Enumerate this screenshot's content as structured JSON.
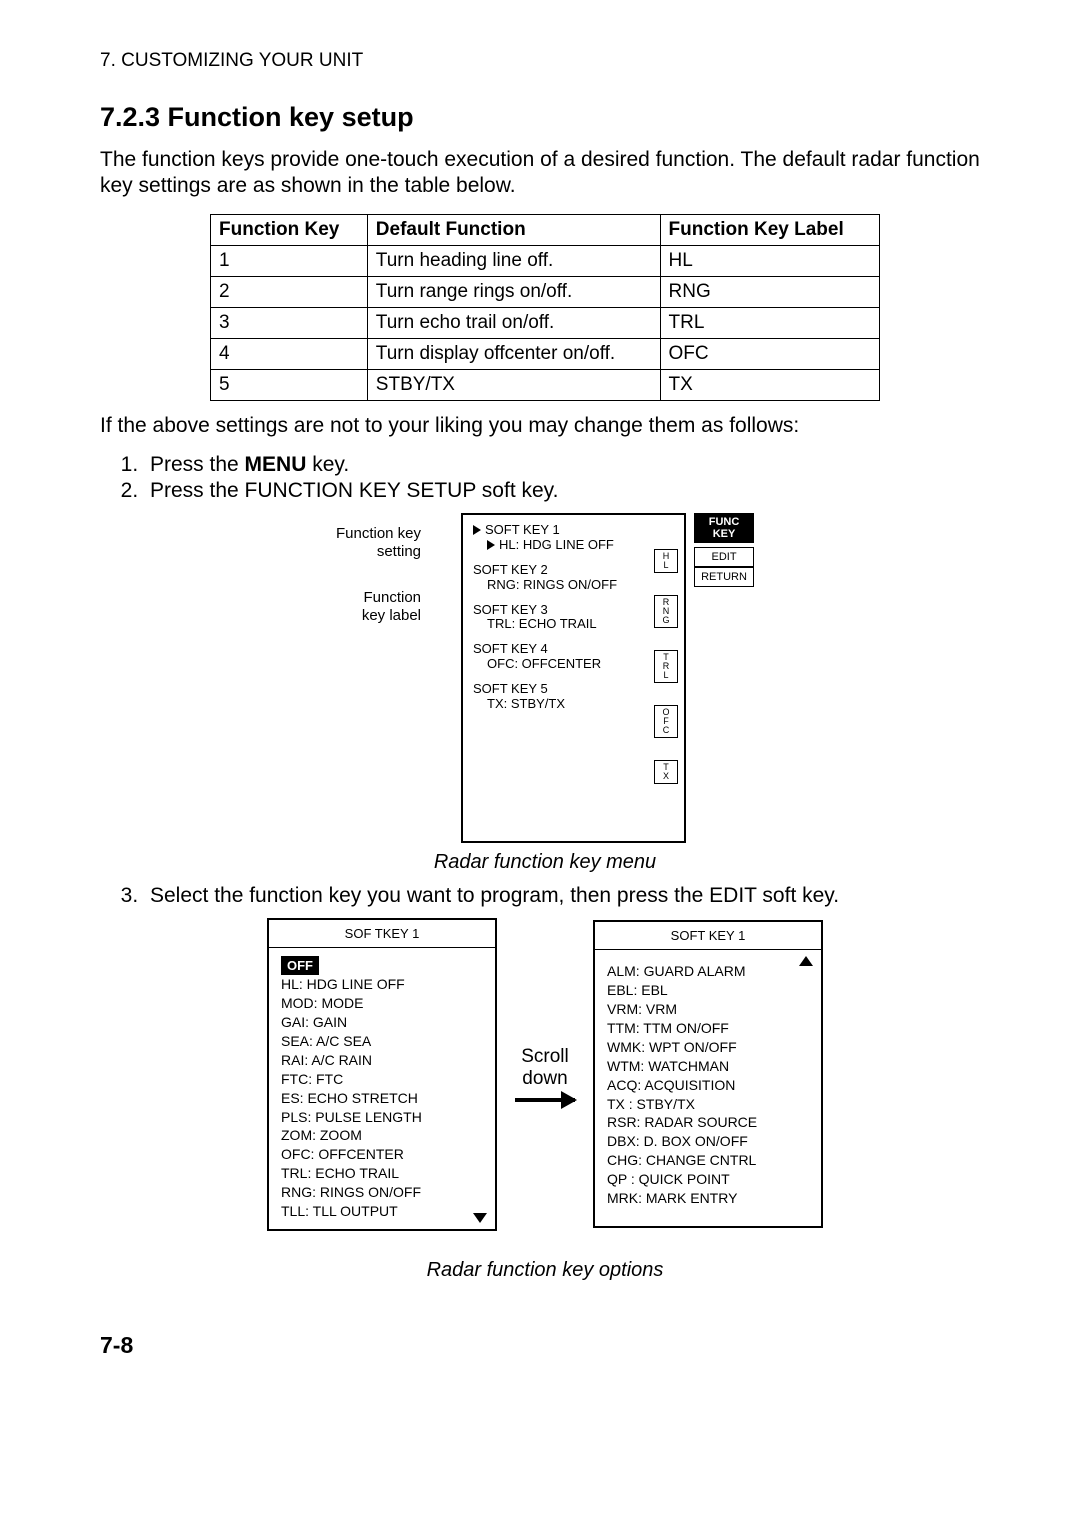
{
  "running_head": "7. CUSTOMIZING YOUR UNIT",
  "heading": "7.2.3   Function key setup",
  "intro": "The function keys provide one-touch execution of a desired function. The default radar function key settings are as shown in the table below.",
  "table_headers": [
    "Function Key",
    "Default Function",
    "Function Key Label"
  ],
  "table_rows": [
    [
      "1",
      "Turn heading line off.",
      "HL"
    ],
    [
      "2",
      "Turn range rings on/off.",
      "RNG"
    ],
    [
      "3",
      "Turn echo trail on/off.",
      "TRL"
    ],
    [
      "4",
      "Turn display offcenter on/off.",
      "OFC"
    ],
    [
      "5",
      "STBY/TX",
      "TX"
    ]
  ],
  "after_table": "If the above settings are not to your liking you may change them as follows:",
  "steps": {
    "s1a": "Press the ",
    "s1b": "MENU",
    "s1c": " key.",
    "s2": "Press the FUNCTION KEY SETUP soft key."
  },
  "fig1": {
    "label_setting": "Function key\nsetting",
    "label_fnlabel": "Function\nkey label",
    "menu": {
      "sk1": "SOFT KEY 1",
      "sk1val": "HL: HDG LINE OFF",
      "sk2": "SOFT KEY 2",
      "sk2val": "RNG: RINGS ON/OFF",
      "sk3": "SOFT KEY 3",
      "sk3val": "TRL: ECHO TRAIL",
      "sk4": "SOFT KEY 4",
      "sk4val": "OFC: OFFCENTER",
      "sk5": "SOFT KEY 5",
      "sk5val": "TX: STBY/TX"
    },
    "keylabels": [
      "H\nL",
      "R\nN\nG",
      "T\nR\nL",
      "O\nF\nC",
      "T\nX"
    ],
    "soft": {
      "title": "FUNC\nKEY",
      "edit": "EDIT",
      "return": "RETURN"
    },
    "caption": "Radar function key menu"
  },
  "step3": "Select the function key you want to program, then press the EDIT soft key.",
  "fig2": {
    "left_title": "SOF TKEY 1",
    "left_items": [
      "OFF",
      "HL: HDG LINE OFF",
      "MOD: MODE",
      "GAI: GAIN",
      "SEA: A/C SEA",
      "RAI: A/C RAIN",
      "FTC: FTC",
      "ES: ECHO STRETCH",
      "PLS: PULSE LENGTH",
      "ZOM: ZOOM",
      "OFC: OFFCENTER",
      "TRL: ECHO TRAIL",
      "RNG: RINGS ON/OFF",
      "TLL: TLL OUTPUT"
    ],
    "scroll": "Scroll\ndown",
    "right_title": "SOFT KEY 1",
    "right_items": [
      "ALM: GUARD ALARM",
      "EBL: EBL",
      "VRM: VRM",
      "TTM: TTM ON/OFF",
      "WMK: WPT ON/OFF",
      "WTM: WATCHMAN",
      "ACQ: ACQUISITION",
      "TX   : STBY/TX",
      "RSR: RADAR SOURCE",
      "DBX: D. BOX ON/OFF",
      "CHG: CHANGE CNTRL",
      "QP   : QUICK POINT",
      "MRK: MARK ENTRY"
    ],
    "caption": "Radar function key options"
  },
  "page_num": "7-8"
}
